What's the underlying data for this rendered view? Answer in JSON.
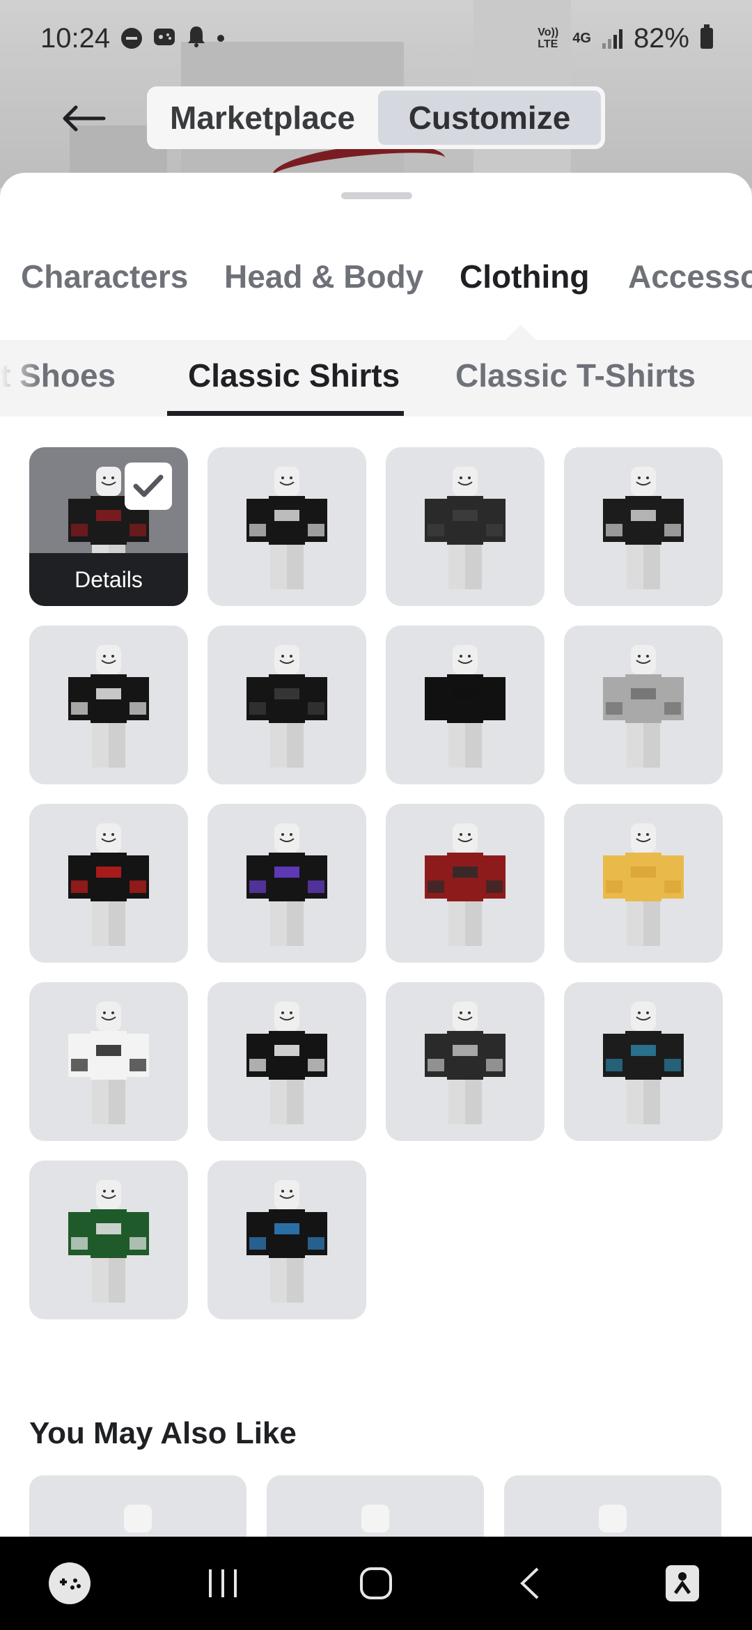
{
  "status_bar": {
    "time": "10:24",
    "network_label_top": "Vo)) LTE",
    "network_label": "4G",
    "battery_percent": "82%",
    "icons": [
      "minus-circle-icon",
      "game-controller-icon",
      "bell-icon",
      "dot-icon",
      "signal-icon",
      "battery-icon"
    ]
  },
  "header": {
    "back_icon": "arrow-left-icon",
    "segments": [
      {
        "label": "Marketplace",
        "active": false
      },
      {
        "label": "Customize",
        "active": true
      }
    ]
  },
  "category_tabs": [
    {
      "label": "Characters",
      "active": false
    },
    {
      "label": "Head & Body",
      "active": false
    },
    {
      "label": "Clothing",
      "active": true
    },
    {
      "label": "Accesso",
      "active": false
    }
  ],
  "sub_tabs": [
    {
      "label": "t Shoes",
      "active": false
    },
    {
      "label": "Classic Shirts",
      "active": true
    },
    {
      "label": "Classic T-Shirts",
      "active": false
    }
  ],
  "items": [
    {
      "shirt": "#1a1a1a",
      "accent": "#8a1b20",
      "selected": true
    },
    {
      "shirt": "#161616",
      "accent": "#d9d9d9",
      "selected": false
    },
    {
      "shirt": "#2a2a2a",
      "accent": "#3e3e3e",
      "selected": false
    },
    {
      "shirt": "#1c1c1c",
      "accent": "#cfcfcf",
      "selected": false
    },
    {
      "shirt": "#151515",
      "accent": "#e6e6e6",
      "selected": false
    },
    {
      "shirt": "#151515",
      "accent": "#3b3b3b",
      "selected": false
    },
    {
      "shirt": "#111111",
      "accent": "#111111",
      "selected": false
    },
    {
      "shirt": "#a9a9a9",
      "accent": "#6e6e6e",
      "selected": false
    },
    {
      "shirt": "#141414",
      "accent": "#c21c1c",
      "selected": false
    },
    {
      "shirt": "#151515",
      "accent": "#6b3fd1",
      "selected": false
    },
    {
      "shirt": "#8e1b1b",
      "accent": "#2a2a2a",
      "selected": false
    },
    {
      "shirt": "#e9b94a",
      "accent": "#d9a534",
      "selected": false
    },
    {
      "shirt": "#f3f3f3",
      "accent": "#1f1f1f",
      "selected": false
    },
    {
      "shirt": "#141414",
      "accent": "#f0f0f0",
      "selected": false
    },
    {
      "shirt": "#2a2a2a",
      "accent": "#bdbdbd",
      "selected": false
    },
    {
      "shirt": "#1c1c1c",
      "accent": "#2a7fa0",
      "selected": false
    },
    {
      "shirt": "#1e5a2a",
      "accent": "#e8e8e8",
      "selected": false
    },
    {
      "shirt": "#141414",
      "accent": "#2f7fc1",
      "selected": false
    }
  ],
  "details_label": "Details",
  "section_title": "You May Also Like",
  "nav_bar": {
    "icons": [
      "game-launcher-icon",
      "recent-apps-icon",
      "home-icon",
      "back-icon",
      "accessibility-icon"
    ]
  }
}
